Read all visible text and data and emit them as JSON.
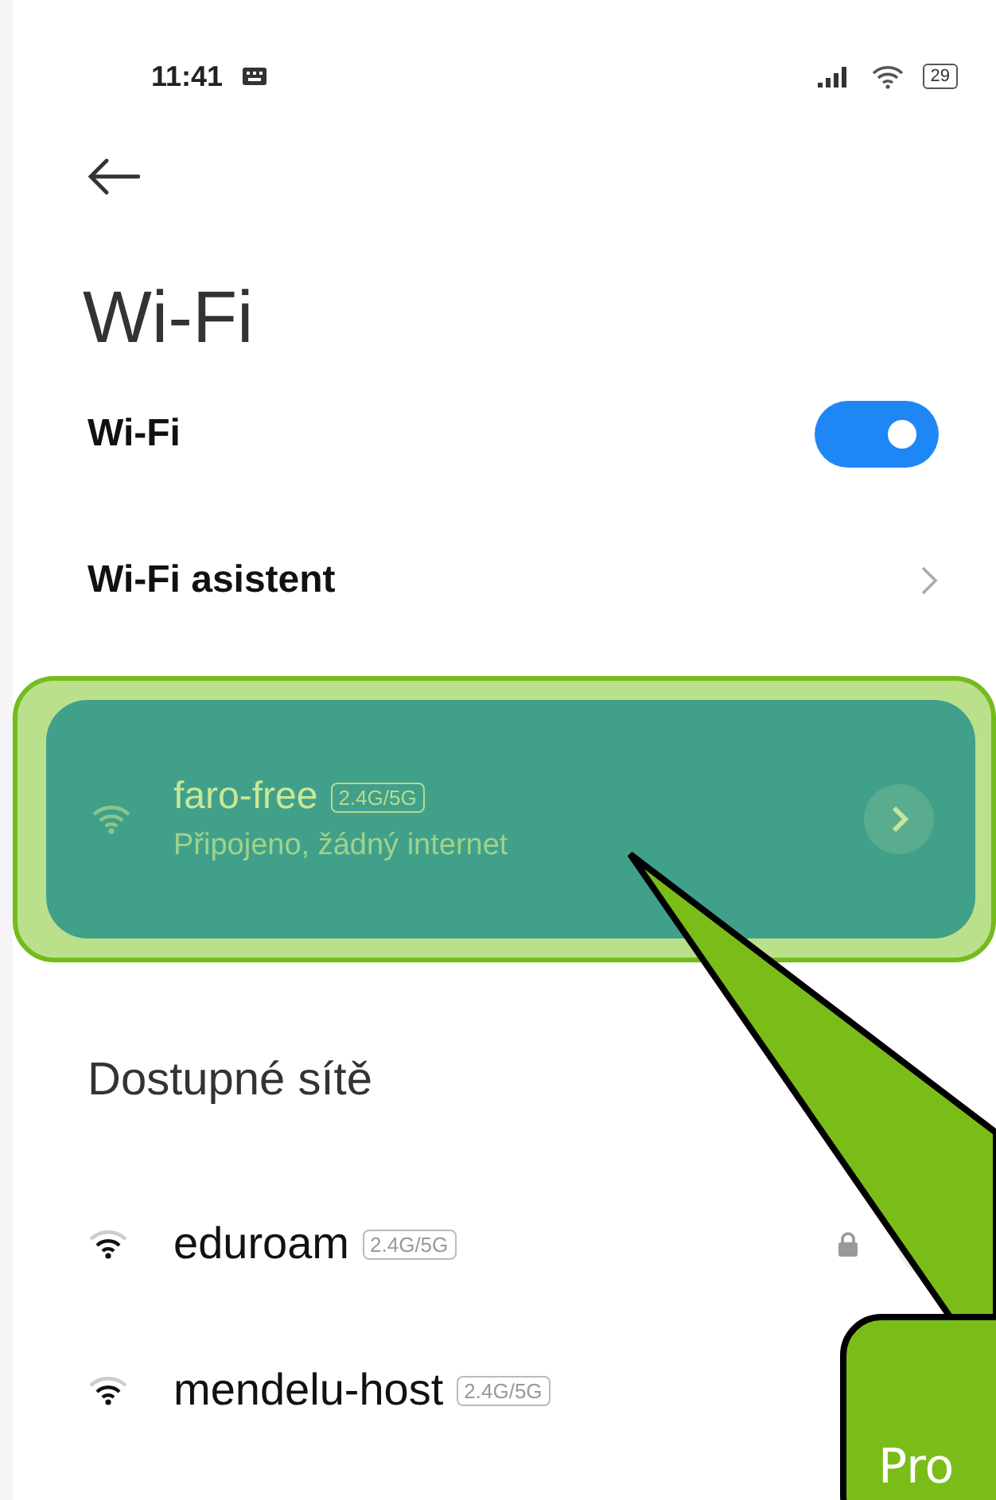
{
  "status_bar": {
    "time": "11:41",
    "battery": "29"
  },
  "title": "Wi-Fi",
  "settings": [
    {
      "kind": "toggle",
      "label": "Wi-Fi",
      "on": true
    },
    {
      "kind": "link",
      "label": "Wi-Fi asistent"
    }
  ],
  "connected": {
    "name": "faro-free",
    "band": "2.4G/5G",
    "status": "Připojeno, žádný internet",
    "highlighted": true
  },
  "available_header": "Dostupné sítě",
  "networks": [
    {
      "name": "eduroam",
      "band": "2.4G/5G",
      "locked": true
    },
    {
      "name": "mendelu-host",
      "band": "2.4G/5G",
      "locked": false
    }
  ],
  "callout": {
    "text": "Pro"
  }
}
